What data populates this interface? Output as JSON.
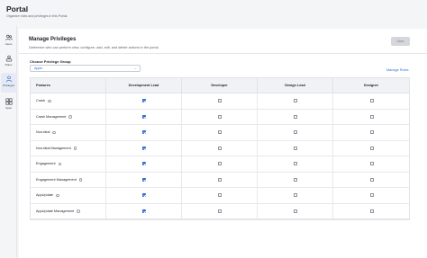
{
  "header": {
    "title": "Portal",
    "subtitle": "Organize roles and privileges in this Portal."
  },
  "sidebar": {
    "items": [
      {
        "label": "Users",
        "icon": "users-icon",
        "active": false
      },
      {
        "label": "Roles",
        "icon": "roles-icon",
        "active": false
      },
      {
        "label": "Privileges",
        "icon": "privileges-icon",
        "active": true
      },
      {
        "label": "Apps",
        "icon": "apps-icon",
        "active": false
      }
    ]
  },
  "panel": {
    "title": "Manage Privileges",
    "description": "Determine who can perform view, configure, add, edit, and delete actions in the portal.",
    "save_label": "Save",
    "group_label": "Choose Privilege Group",
    "group_value": "Apple",
    "manage_roles_label": "Manage Roles"
  },
  "table": {
    "columns": [
      "Features",
      "Development Lead",
      "Developer",
      "Design Lead",
      "Designer"
    ],
    "rows": [
      {
        "feature": "Crash",
        "checked": [
          true,
          false,
          false,
          false
        ]
      },
      {
        "feature": "Crash Management",
        "checked": [
          true,
          false,
          false,
          false
        ]
      },
      {
        "feature": "Non-fatal",
        "checked": [
          true,
          false,
          false,
          false
        ]
      },
      {
        "feature": "Non-fatal Management",
        "checked": [
          true,
          false,
          false,
          false
        ]
      },
      {
        "feature": "Engagement",
        "checked": [
          true,
          false,
          false,
          false
        ]
      },
      {
        "feature": "Engagement Management",
        "checked": [
          true,
          false,
          false,
          false
        ]
      },
      {
        "feature": "AppUpdate",
        "checked": [
          true,
          false,
          false,
          false
        ]
      },
      {
        "feature": "AppUpdate Management",
        "checked": [
          true,
          false,
          false,
          false
        ]
      }
    ]
  },
  "colors": {
    "accent": "#2f6fd8",
    "active_nav": "#e6eaf6"
  }
}
